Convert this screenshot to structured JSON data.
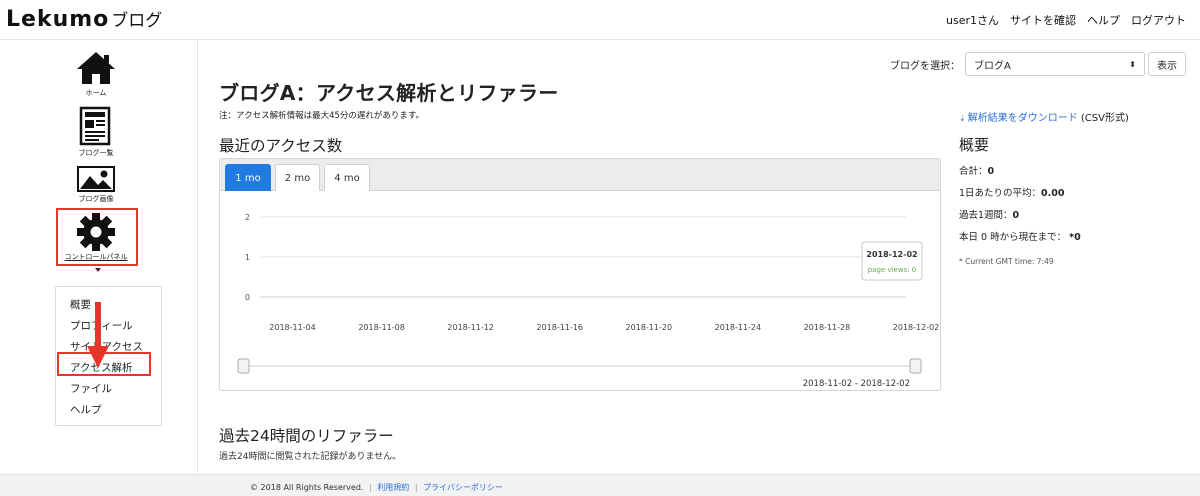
{
  "header": {
    "logo": "Lekumo",
    "logo_sub": "ブログ",
    "nav": [
      "user1さん",
      "サイトを確認",
      "ヘルプ",
      "ログアウト"
    ]
  },
  "sidebar": {
    "items": [
      {
        "label": "ホーム",
        "icon": "home-icon"
      },
      {
        "label": "ブログ一覧",
        "icon": "blog-list-icon"
      },
      {
        "label": "ブログ画像",
        "icon": "image-icon"
      },
      {
        "label": "コントロールパネル",
        "icon": "gear-icon"
      }
    ],
    "submenu": [
      "概要",
      "プロフィール",
      "サイトアクセス",
      "アクセス解析",
      "ファイル",
      "ヘルプ"
    ],
    "highlight_color": "#e8352b"
  },
  "main": {
    "select_label": "ブログを選択：",
    "selected_blog": "ブログA",
    "show_button": "表示",
    "title": "ブログA：アクセス解析とリファラー",
    "note": "注：アクセス解析情報は最大45分の遅れがあります。",
    "download_link": "解析結果をダウンロード",
    "download_suffix": "(CSV形式)",
    "recent_title": "最近のアクセス数",
    "tabs": [
      "1 mo",
      "2 mo",
      "4 mo"
    ],
    "active_tab": "1 mo",
    "range_label": "2018-11-02 - 2018-12-02",
    "tooltip": {
      "date": "2018-12-02",
      "text": "page views: 0"
    },
    "summary": {
      "title": "概要",
      "rows": [
        {
          "label": "合計：",
          "value": "0"
        },
        {
          "label": "1日あたりの平均：",
          "value": "0.00"
        },
        {
          "label": "過去1週間：",
          "value": "0"
        },
        {
          "label": "本日 0 時から現在まで：",
          "value": "*0"
        }
      ],
      "gmt": "* Current GMT time: 7:49"
    },
    "referrer_title": "過去24時間のリファラー",
    "referrer_text": "過去24時間に閲覧された記録がありません。"
  },
  "chart_data": {
    "type": "line",
    "x_ticks": [
      "2018-11-04",
      "2018-11-08",
      "2018-11-12",
      "2018-11-16",
      "2018-11-20",
      "2018-11-24",
      "2018-11-28",
      "2018-12-02"
    ],
    "y_ticks": [
      0,
      1,
      2
    ],
    "ylim": [
      0,
      2
    ],
    "xlim": [
      "2018-11-02",
      "2018-12-02"
    ],
    "series": [
      {
        "values": [
          0
        ]
      }
    ],
    "accent_color": "#1f7be0",
    "tooltip_value_color": "#6aa84f"
  },
  "footer": {
    "copyright": "© 2018 All Rights Reserved.",
    "links": [
      "利用規約",
      "プライバシーポリシー"
    ]
  }
}
